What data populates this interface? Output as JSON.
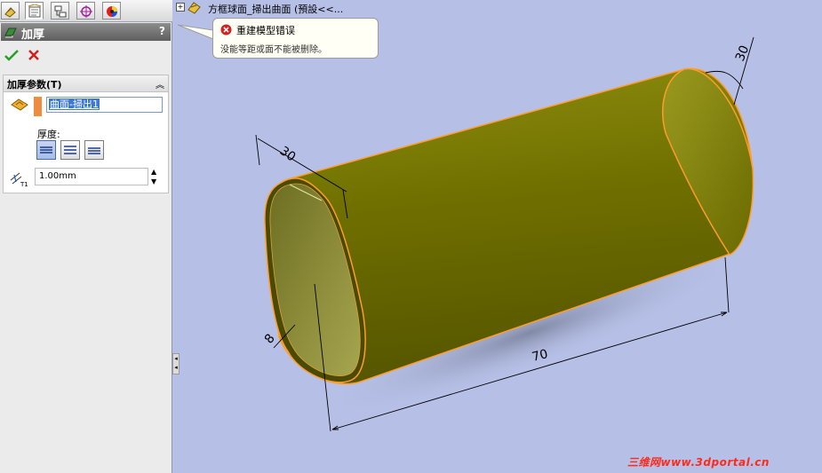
{
  "tabs": [
    {
      "name": "feature-manager",
      "icon": "feature-tree-icon"
    },
    {
      "name": "property-manager",
      "icon": "property-sheet-icon"
    },
    {
      "name": "configuration-manager",
      "icon": "configuration-icon"
    },
    {
      "name": "dimxpert-manager",
      "icon": "crosshair-icon"
    },
    {
      "name": "display-manager",
      "icon": "color-wheel-icon"
    }
  ],
  "property_manager": {
    "title": "加厚",
    "help": "?",
    "ok_icon": "green-check-icon",
    "cancel_icon": "red-x-icon",
    "group_title": "加厚参数(T)",
    "face_selection": "曲面-掃出1",
    "thickness_label": "厚度:",
    "thicken_side_icons": [
      "thicken-side1-icon",
      "thicken-both-icon",
      "thicken-side2-icon"
    ],
    "selected_side_index": 0,
    "distance_value": "1.00mm",
    "distance_icon": "thickness-t1-icon"
  },
  "feature_tree": {
    "root_label": "方框球面_掃出曲面  (預設<<..."
  },
  "error_balloon": {
    "title": "重建模型错误",
    "message": "没能等距或面不能被删除。"
  },
  "model": {
    "part_color": "#7c7c00",
    "edge_color": "#ff9c2a",
    "dimensions": [
      {
        "name": "length",
        "text": "70"
      },
      {
        "name": "angle",
        "text": "30"
      },
      {
        "name": "width",
        "text": "30"
      },
      {
        "name": "corner-radius",
        "text": "8"
      }
    ]
  },
  "watermark": "三维网www.3dportal.cn",
  "colors": {
    "viewport_bg": "#b6c0e6",
    "accent": "#3b79d4",
    "error": "#d42020"
  }
}
